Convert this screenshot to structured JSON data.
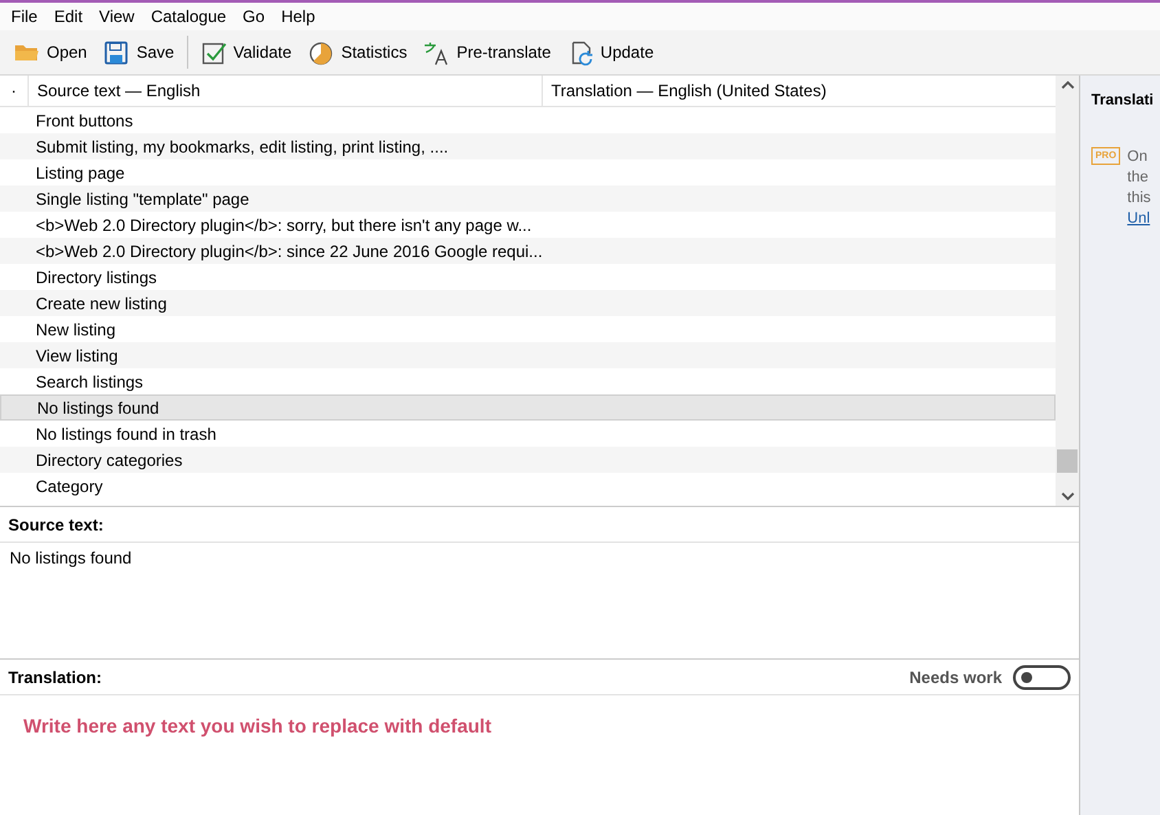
{
  "menu": [
    "File",
    "Edit",
    "View",
    "Catalogue",
    "Go",
    "Help"
  ],
  "toolbar": [
    {
      "label": "Open"
    },
    {
      "label": "Save"
    },
    {
      "label": "Validate"
    },
    {
      "label": "Statistics"
    },
    {
      "label": "Pre-translate"
    },
    {
      "label": "Update"
    }
  ],
  "table": {
    "columns": [
      "·",
      "Source text — English",
      "Translation — English (United States)"
    ],
    "rows": [
      {
        "source": "Front buttons",
        "selected": false
      },
      {
        "source": "Submit listing, my bookmarks, edit listing, print listing, ....",
        "selected": false
      },
      {
        "source": "Listing page",
        "selected": false
      },
      {
        "source": "Single listing \"template\" page",
        "selected": false
      },
      {
        "source": "<b>Web 2.0 Directory plugin</b>: sorry, but there isn't any page w...",
        "selected": false
      },
      {
        "source": "<b>Web 2.0 Directory plugin</b>: since 22 June 2016 Google requi...",
        "selected": false
      },
      {
        "source": "Directory listings",
        "selected": false
      },
      {
        "source": "Create new listing",
        "selected": false
      },
      {
        "source": "New listing",
        "selected": false
      },
      {
        "source": "View listing",
        "selected": false
      },
      {
        "source": "Search listings",
        "selected": false
      },
      {
        "source": "No listings found",
        "selected": true
      },
      {
        "source": "No listings found in trash",
        "selected": false
      },
      {
        "source": "Directory categories",
        "selected": false
      },
      {
        "source": "Category",
        "selected": false
      }
    ]
  },
  "source_panel": {
    "title": "Source text:",
    "text": "No listings found"
  },
  "translation_panel": {
    "title": "Translation:",
    "needs_work_label": "Needs work",
    "needs_work": false,
    "value": "Write here any text you wish to replace with default"
  },
  "side_panel": {
    "title": "Translati",
    "badge": "PRO",
    "lines": [
      "On",
      "the",
      "this"
    ],
    "link": "Unl"
  }
}
